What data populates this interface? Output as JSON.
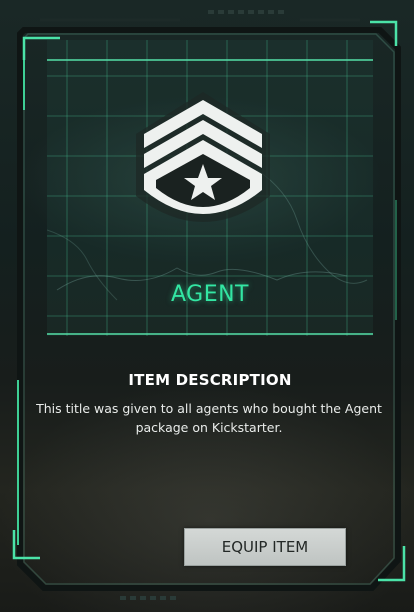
{
  "item": {
    "title": "AGENT",
    "emblem_icon": "sergeant-rank-star-icon"
  },
  "description": {
    "heading": "ITEM DESCRIPTION",
    "text": "This title was given to all agents who bought the Agent package on Kickstarter."
  },
  "actions": {
    "equip_label": "EQUIP ITEM"
  },
  "colors": {
    "accent": "#33e6a3",
    "frame": "#3ecf95",
    "button_bg": "#cfd3d1",
    "button_text": "#232826"
  }
}
